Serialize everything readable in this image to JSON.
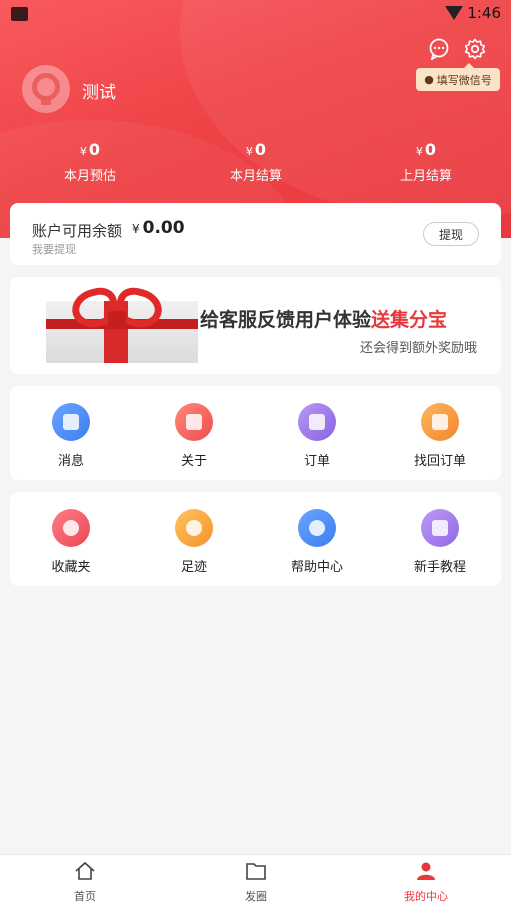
{
  "status_bar": {
    "time": "1:46"
  },
  "header": {
    "username": "测试",
    "wechat_tip": "填写微信号",
    "stats": [
      {
        "currency": "¥",
        "value": "0",
        "label": "本月预估"
      },
      {
        "currency": "¥",
        "value": "0",
        "label": "本月结算"
      },
      {
        "currency": "¥",
        "value": "0",
        "label": "上月结算"
      }
    ]
  },
  "balance": {
    "label": "账户可用余额",
    "currency": "¥",
    "value": "0.00",
    "sub": "我要提现",
    "withdraw_label": "提现"
  },
  "banner": {
    "title_main": "给客服反馈用户体验",
    "title_highlight": "送集分宝",
    "subtitle": "还会得到额外奖励哦"
  },
  "grid1": [
    {
      "label": "消息",
      "icon": "message-icon",
      "color": "#4f8df5"
    },
    {
      "label": "关于",
      "icon": "about-icon",
      "color": "#f0605a"
    },
    {
      "label": "订单",
      "icon": "order-icon",
      "color": "#9a73e8"
    },
    {
      "label": "找回订单",
      "icon": "find-order-icon",
      "color": "#f59a3b"
    }
  ],
  "grid2": [
    {
      "label": "收藏夹",
      "icon": "favorites-icon",
      "color": "#f05a66"
    },
    {
      "label": "足迹",
      "icon": "footprint-icon",
      "color": "#f7a53a"
    },
    {
      "label": "帮助中心",
      "icon": "help-icon",
      "color": "#4f8df5"
    },
    {
      "label": "新手教程",
      "icon": "tutorial-icon",
      "color": "#a07ae8"
    }
  ],
  "tabbar": [
    {
      "label": "首页",
      "icon": "home-icon"
    },
    {
      "label": "发圈",
      "icon": "folder-icon"
    },
    {
      "label": "我的中心",
      "icon": "user-icon",
      "active": true
    }
  ],
  "colors": {
    "accent": "#e8383d",
    "header_start": "#f85a5e",
    "header_end": "#e8383d"
  }
}
